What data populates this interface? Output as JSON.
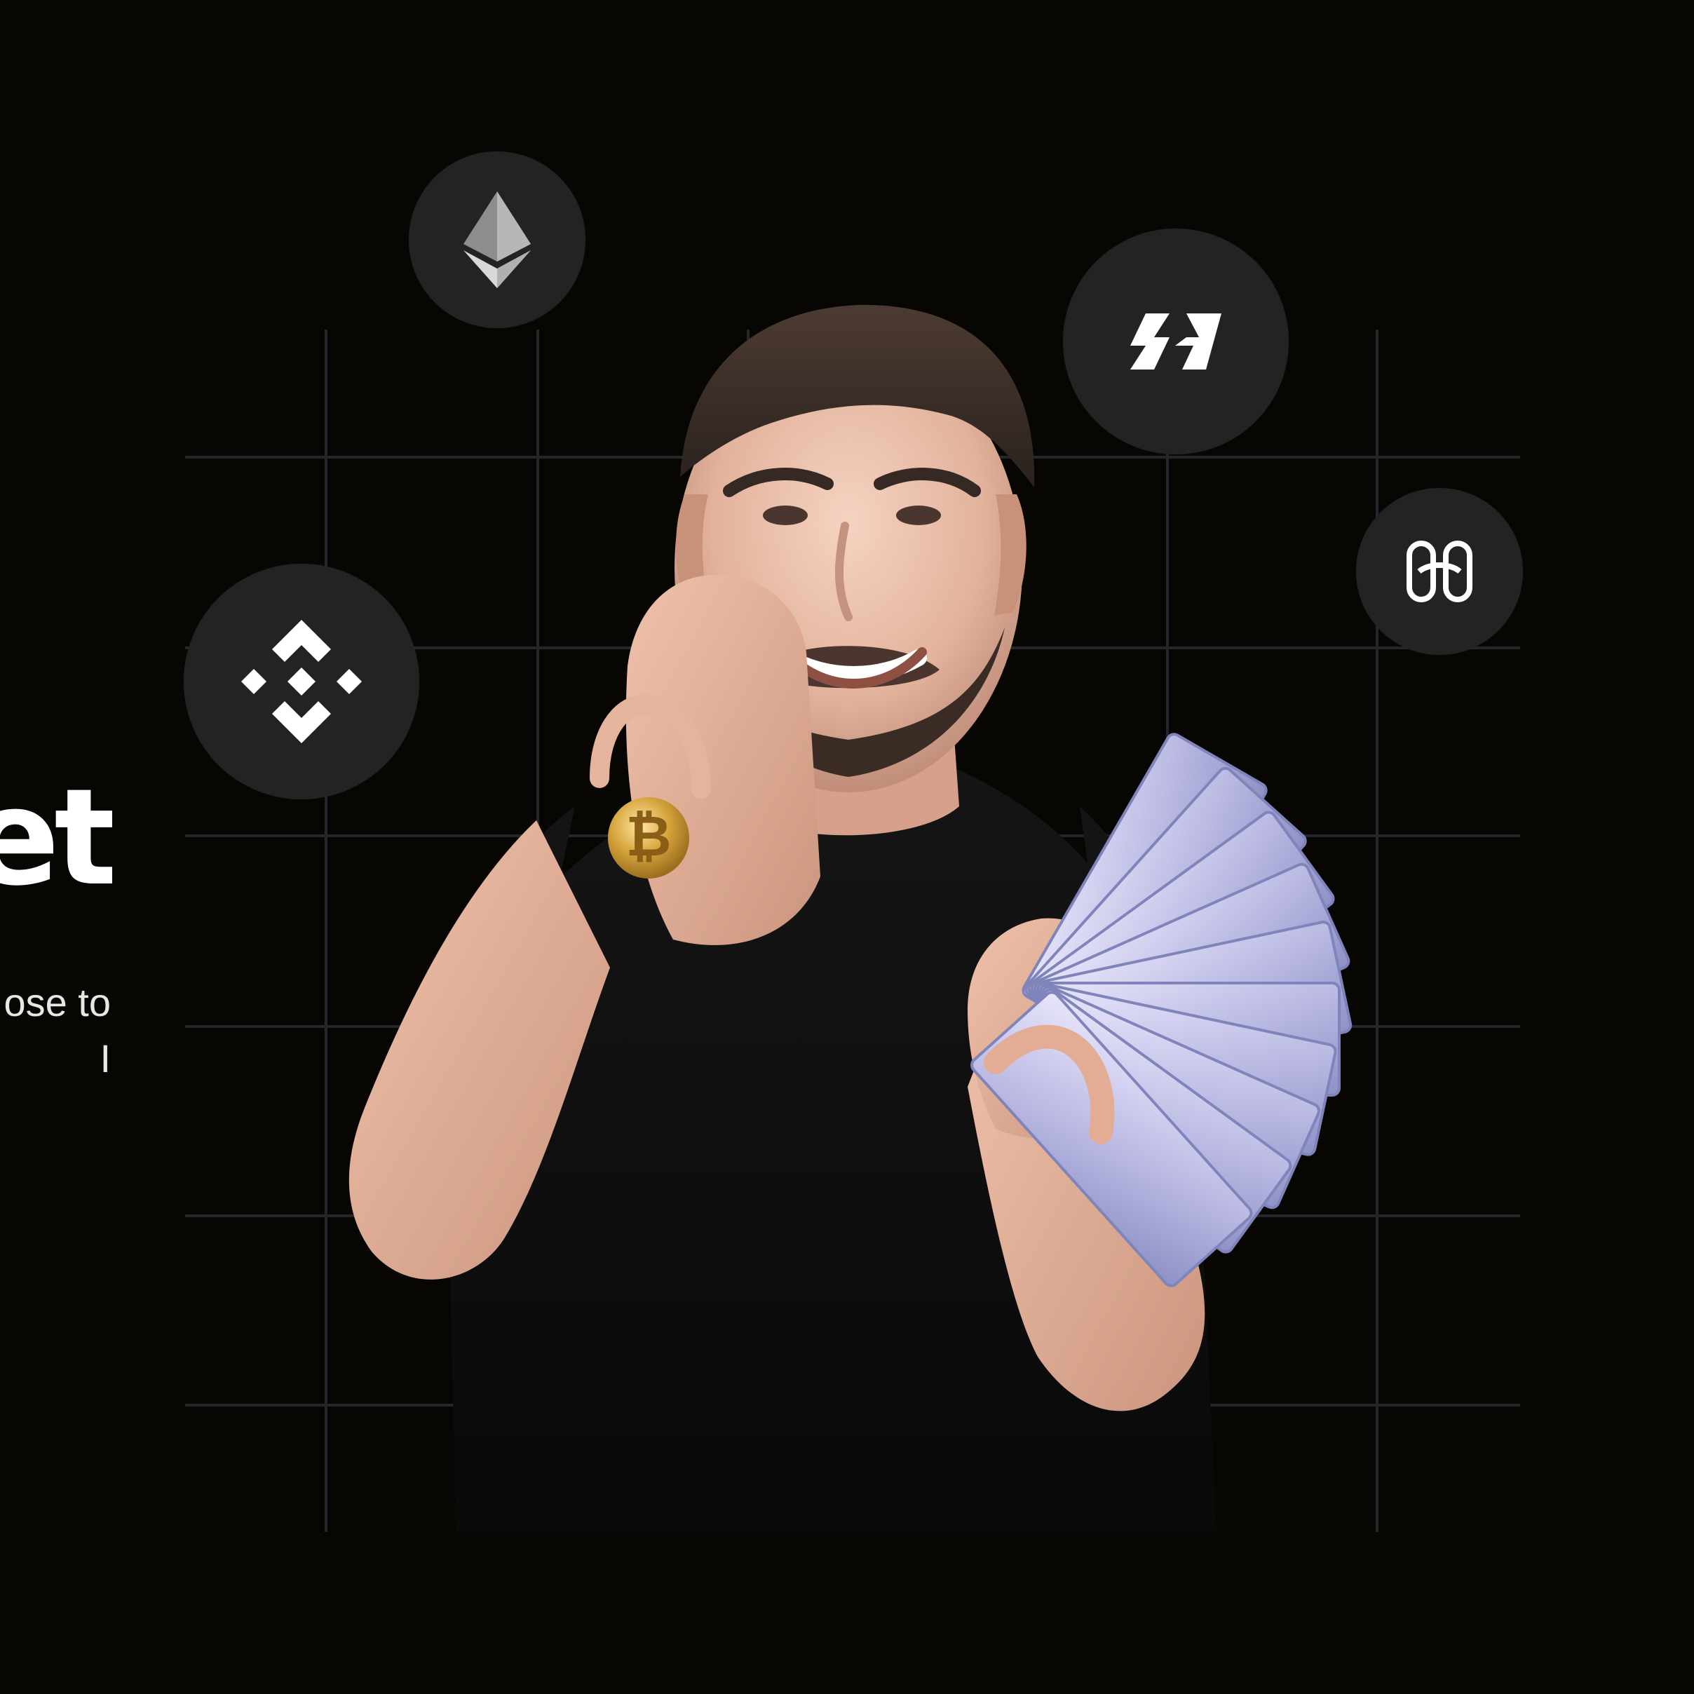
{
  "hero": {
    "headline_visible": "et",
    "subtext_line_1": "ose to",
    "subtext_line_2": "I"
  },
  "icons": {
    "ethereum": "ethereum-icon",
    "binance": "binance-icon",
    "hive": "hive-icon",
    "harmony": "harmony-icon",
    "bitcoin": "bitcoin-coin-icon"
  },
  "colors": {
    "background": "#080602",
    "grid": "#23262b",
    "bubble": "#232323",
    "text": "#ffffff"
  }
}
